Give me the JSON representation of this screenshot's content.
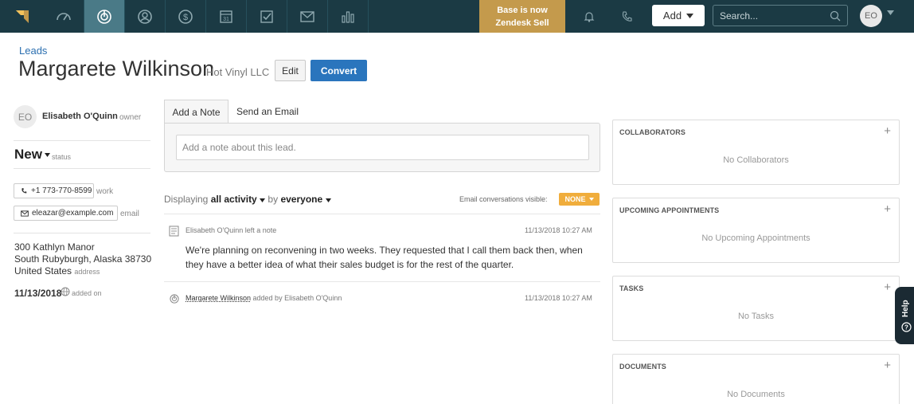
{
  "nav": {
    "banner_line1": "Base is now",
    "banner_line2": "Zendesk Sell",
    "add_label": "Add",
    "search_placeholder": "Search...",
    "user_initials": "EO",
    "colors": {
      "bar": "#1b3a44",
      "active": "#4a7a87",
      "banner": "#c49a4c"
    },
    "icons": [
      "logo-icon",
      "dashboard-icon",
      "leads-icon",
      "contacts-icon",
      "deals-icon",
      "calendar-icon",
      "tasks-icon",
      "communications-icon",
      "reports-icon",
      "bell-icon",
      "phone-icon",
      "search-icon"
    ],
    "calendar_day": "31"
  },
  "header": {
    "breadcrumb": "Leads",
    "name": "Margarete Wilkinson",
    "company": "Hot Vinyl LLC",
    "edit_label": "Edit",
    "convert_label": "Convert"
  },
  "sidebar": {
    "owner_initials": "EO",
    "owner_name": "Elisabeth O'Quinn",
    "owner_role": "owner",
    "status_value": "New",
    "status_label": "status",
    "phone": "+1 773-770-8599",
    "phone_label": "work",
    "email": "eleazar@example.com",
    "email_label": "email",
    "address_line1": "300 Kathlyn Manor",
    "address_line2": "South Rubyburgh, Alaska 38730",
    "address_line3": "United States",
    "address_label": "address",
    "added_date": "11/13/2018",
    "added_label": "added on"
  },
  "composer": {
    "tab_note": "Add a Note",
    "tab_email": "Send an Email",
    "placeholder": "Add a note about this lead."
  },
  "feed": {
    "displaying": "Displaying",
    "activity": "all activity",
    "by": "by",
    "everyone": "everyone",
    "email_visible_label": "Email conversations visible:",
    "email_visible_value": "NONE",
    "items": [
      {
        "header": "Elisabeth O'Quinn left a note",
        "time": "11/13/2018 10:27 AM",
        "body": "We're planning on reconvening in two weeks. They requested that I call them back then, when they have a better idea of what their sales budget is for the rest of the quarter."
      },
      {
        "link": "Margarete Wilkinson",
        "header_rest": " added by Elisabeth O'Quinn",
        "time": "11/13/2018 10:27 AM"
      }
    ]
  },
  "panels": [
    {
      "title": "COLLABORATORS",
      "empty": "No Collaborators"
    },
    {
      "title": "UPCOMING APPOINTMENTS",
      "empty": "No Upcoming Appointments"
    },
    {
      "title": "TASKS",
      "empty": "No Tasks"
    },
    {
      "title": "DOCUMENTS",
      "empty": "No Documents"
    }
  ],
  "help": {
    "label": "Help"
  }
}
